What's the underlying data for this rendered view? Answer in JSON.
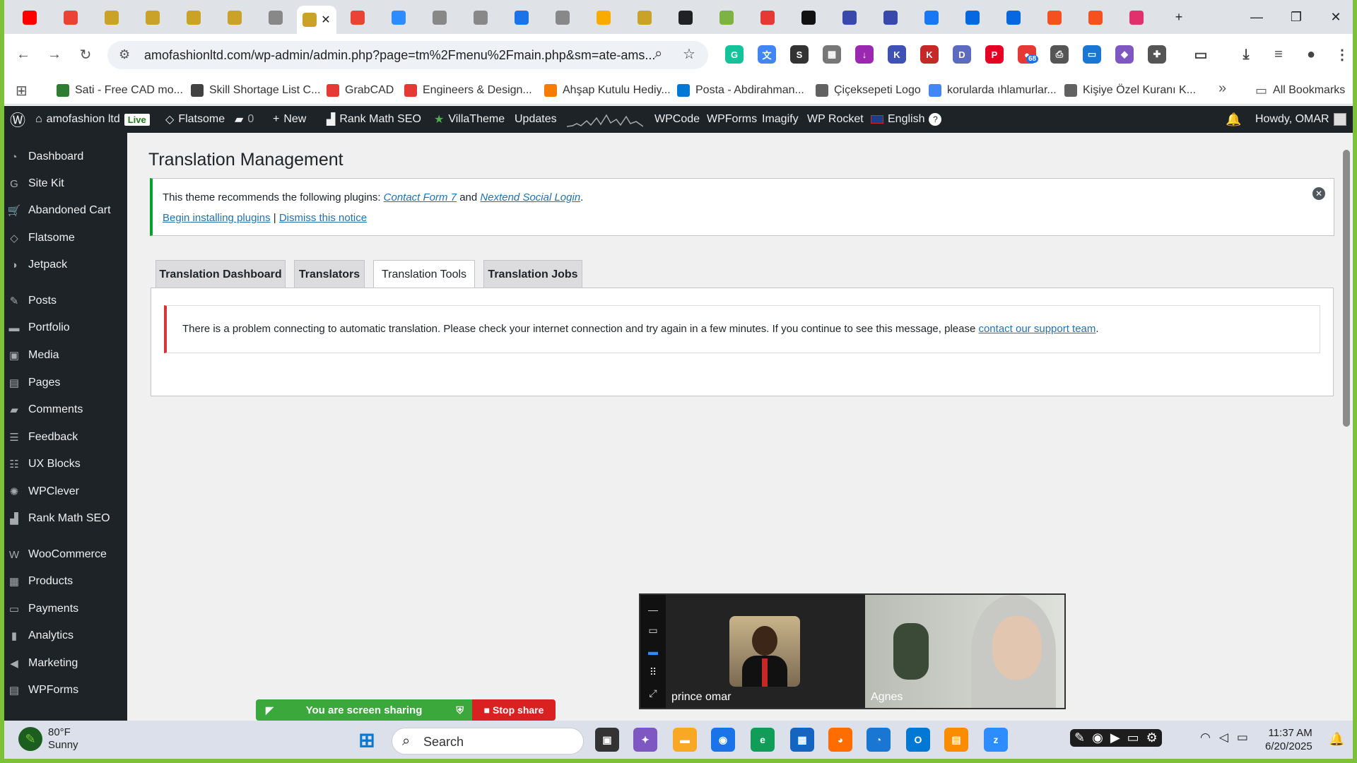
{
  "browser": {
    "url": "amofashionltd.com/wp-admin/admin.php?page=tm%2Fmenu%2Fmain.php&sm=ate-ams...",
    "tabs": [
      {
        "icon": "youtube-icon",
        "color": "#ff0000"
      },
      {
        "icon": "gmail-icon",
        "color": "#ea4335"
      },
      {
        "icon": "wp-icon",
        "color": "#c9a227"
      },
      {
        "icon": "wp-icon",
        "color": "#c9a227"
      },
      {
        "icon": "wp-icon",
        "color": "#c9a227"
      },
      {
        "icon": "wp-icon",
        "color": "#c9a227"
      },
      {
        "icon": "loading-icon",
        "color": "#888888"
      },
      {
        "icon": "wp-icon",
        "color": "#c9a227",
        "active": true
      },
      {
        "icon": "gmail-icon",
        "color": "#ea4335"
      },
      {
        "icon": "zoom-icon",
        "color": "#2d8cff"
      },
      {
        "icon": "loading-icon",
        "color": "#888888"
      },
      {
        "icon": "loading-icon",
        "color": "#888888"
      },
      {
        "icon": "chrome-icon",
        "color": "#1a73e8"
      },
      {
        "icon": "wp-icon",
        "color": "#888888"
      },
      {
        "icon": "analytics-icon",
        "color": "#f9ab00"
      },
      {
        "icon": "wp-icon",
        "color": "#c9a227"
      },
      {
        "icon": "openai-icon",
        "color": "#202123"
      },
      {
        "icon": "d-icon",
        "color": "#7cb342"
      },
      {
        "icon": "alert-icon",
        "color": "#e53935"
      },
      {
        "icon": "amazon-icon",
        "color": "#111111"
      },
      {
        "icon": "flag-icon",
        "color": "#3949ab"
      },
      {
        "icon": "flag-icon",
        "color": "#3949ab"
      },
      {
        "icon": "facebook-icon",
        "color": "#1877f2"
      },
      {
        "icon": "meta-icon",
        "color": "#0668e1"
      },
      {
        "icon": "meta-icon",
        "color": "#0668e1"
      },
      {
        "icon": "pdf-icon",
        "color": "#f4511e"
      },
      {
        "icon": "pdf-icon",
        "color": "#f4511e"
      },
      {
        "icon": "instagram-icon",
        "color": "#e1306c"
      }
    ],
    "new_tab_label": "+",
    "extension_badge": "68",
    "bookmarks": [
      {
        "label": "Sati - Free CAD mo...",
        "color": "#2e7d32"
      },
      {
        "label": "Skill Shortage List C...",
        "color": "#424242"
      },
      {
        "label": "GrabCAD",
        "color": "#e53935"
      },
      {
        "label": "Engineers & Design...",
        "color": "#e53935"
      },
      {
        "label": "Ahşap Kutulu Hediy...",
        "color": "#f57c00"
      },
      {
        "label": "Posta - Abdirahman...",
        "color": "#0078d4"
      },
      {
        "label": "Çiçeksepeti Logo",
        "color": "#616161"
      },
      {
        "label": "korularda ıhlamurlar...",
        "color": "#4285f4"
      },
      {
        "label": "Kişiye Özel Kuranı K...",
        "color": "#616161"
      }
    ],
    "more_bookmarks": "»",
    "all_bookmarks": "All Bookmarks"
  },
  "adminbar": {
    "site": "amofashion ltd",
    "live": "Live",
    "theme": "Flatsome",
    "comments": "0",
    "new": "New",
    "rankmath": "Rank Math SEO",
    "villatheme": "VillaTheme",
    "updates": "Updates",
    "wpcode": "WPCode",
    "wpforms": "WPForms",
    "imagify": "Imagify",
    "wprocket": "WP Rocket",
    "language": "English",
    "howdy": "Howdy, OMAR"
  },
  "sidebar": {
    "items": [
      {
        "label": "Dashboard",
        "icon": "dashboard-icon",
        "glyph": "◔"
      },
      {
        "label": "Site Kit",
        "icon": "sitekit-icon",
        "glyph": "G"
      },
      {
        "label": "Abandoned Cart",
        "icon": "cart-icon",
        "glyph": "🛒"
      },
      {
        "label": "Flatsome",
        "icon": "flatsome-icon",
        "glyph": "◇"
      },
      {
        "label": "Jetpack",
        "icon": "jetpack-icon",
        "glyph": "◑"
      },
      {
        "label": "Posts",
        "icon": "pin-icon",
        "glyph": "✎"
      },
      {
        "label": "Portfolio",
        "icon": "folder-icon",
        "glyph": "▬"
      },
      {
        "label": "Media",
        "icon": "media-icon",
        "glyph": "▣"
      },
      {
        "label": "Pages",
        "icon": "pages-icon",
        "glyph": "▤"
      },
      {
        "label": "Comments",
        "icon": "comment-icon",
        "glyph": "▰"
      },
      {
        "label": "Feedback",
        "icon": "feedback-icon",
        "glyph": "☰"
      },
      {
        "label": "UX Blocks",
        "icon": "blocks-icon",
        "glyph": "☷"
      },
      {
        "label": "WPClever",
        "icon": "bulb-icon",
        "glyph": "✺"
      },
      {
        "label": "Rank Math SEO",
        "icon": "chart-icon",
        "glyph": "▟"
      },
      {
        "label": "WooCommerce",
        "icon": "woo-icon",
        "glyph": "W"
      },
      {
        "label": "Products",
        "icon": "archive-icon",
        "glyph": "▦"
      },
      {
        "label": "Payments",
        "icon": "payment-icon",
        "glyph": "▭"
      },
      {
        "label": "Analytics",
        "icon": "bar-chart-icon",
        "glyph": "▮"
      },
      {
        "label": "Marketing",
        "icon": "megaphone-icon",
        "glyph": "◀"
      },
      {
        "label": "WPForms",
        "icon": "form-icon",
        "glyph": "▤"
      }
    ]
  },
  "page": {
    "title": "Translation Management",
    "notice": {
      "prefix": "This theme recommends the following plugins: ",
      "plugin1": "Contact Form 7",
      "and": " and ",
      "plugin2": "Nextend Social Login",
      "period": ".",
      "begin": "Begin installing plugins",
      "sep": " | ",
      "dismiss": "Dismiss this notice"
    },
    "tabs": [
      "Translation Dashboard",
      "Translators",
      "Translation Tools",
      "Translation Jobs"
    ],
    "active_tab": "Translation Tools",
    "error": {
      "text": "There is a problem connecting to automatic translation. Please check your internet connection and try again in a few minutes. If you continue to see this message, please ",
      "link": "contact our support team",
      "end": "."
    }
  },
  "zoom": {
    "sharing": "You are screen sharing",
    "stop": "Stop share",
    "participant1": "prince omar",
    "participant2": "Agnes"
  },
  "taskbar": {
    "temp": "80°F",
    "condition": "Sunny",
    "search": "Search",
    "time": "11:37 AM",
    "date": "6/20/2025"
  }
}
